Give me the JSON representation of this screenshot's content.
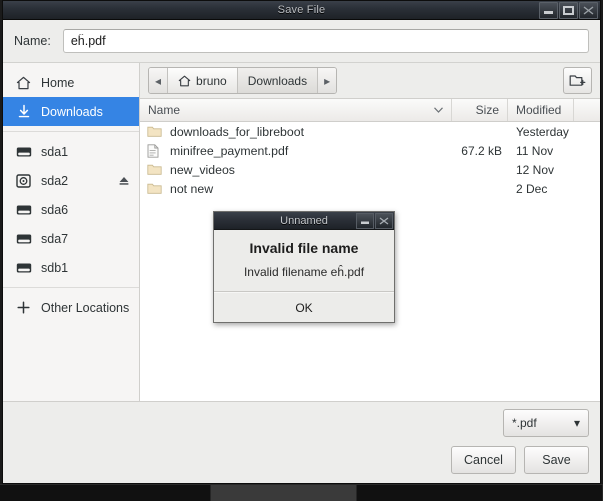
{
  "window": {
    "title": "Save File",
    "controls": [
      {
        "name": "minimize",
        "glyph": "minimize-icon"
      },
      {
        "name": "maximize",
        "glyph": "maximize-icon"
      },
      {
        "name": "close",
        "glyph": "close-icon"
      }
    ]
  },
  "name_row": {
    "label": "Name:",
    "value": "eĥ.pdf",
    "placeholder": ""
  },
  "sidebar": {
    "items": [
      {
        "label": "Home",
        "icon": "home-icon",
        "selected": false,
        "eject": false
      },
      {
        "label": "Downloads",
        "icon": "download-icon",
        "selected": true,
        "eject": false
      },
      {
        "label": "sda1",
        "icon": "drive-harddisk-icon",
        "selected": false,
        "eject": false
      },
      {
        "label": "sda2",
        "icon": "drive-optical-icon",
        "selected": false,
        "eject": true
      },
      {
        "label": "sda6",
        "icon": "drive-harddisk-icon",
        "selected": false,
        "eject": false
      },
      {
        "label": "sda7",
        "icon": "drive-harddisk-icon",
        "selected": false,
        "eject": false
      },
      {
        "label": "sdb1",
        "icon": "drive-harddisk-icon",
        "selected": false,
        "eject": false
      },
      {
        "label": "Other Locations",
        "icon": "plus-icon",
        "selected": false,
        "eject": false
      }
    ]
  },
  "pathbar": {
    "back_arrow": "◂",
    "forward_arrow": "▸",
    "crumbs": [
      {
        "label": "bruno",
        "icon": "home-icon",
        "current": false
      },
      {
        "label": "Downloads",
        "icon": "",
        "current": true
      }
    ],
    "new_folder_button": "create-folder-icon"
  },
  "file_list": {
    "columns": [
      {
        "key": "name",
        "label": "Name",
        "sort": "descending"
      },
      {
        "key": "size",
        "label": "Size"
      },
      {
        "key": "modified",
        "label": "Modified"
      }
    ],
    "rows": [
      {
        "icon": "folder-icon",
        "name": "downloads_for_libreboot",
        "size": "",
        "modified": "Yesterday"
      },
      {
        "icon": "document-icon",
        "name": "minifree_payment.pdf",
        "size": "67.2 kB",
        "modified": "11 Nov"
      },
      {
        "icon": "folder-icon",
        "name": "new_videos",
        "size": "",
        "modified": "12 Nov"
      },
      {
        "icon": "folder-icon",
        "name": "not new",
        "size": "",
        "modified": "2 Dec"
      }
    ]
  },
  "footer": {
    "filter": {
      "label": "*.pdf",
      "chevron": "▾"
    },
    "cancel_label": "Cancel",
    "save_label": "Save"
  },
  "modal": {
    "title": "Unnamed",
    "heading": "Invalid file name",
    "message": "Invalid filename eĥ.pdf",
    "ok_label": "OK",
    "controls": [
      {
        "name": "minimize",
        "glyph": "minimize-icon"
      },
      {
        "name": "close",
        "glyph": "close-icon"
      }
    ]
  },
  "colors": {
    "selection_blue": "#3584e4",
    "window_bg": "#ededeb",
    "sidebar_bg": "#f6f5f4",
    "titlebar_dark": "#2b3038",
    "folder_icon": "#f3e4c3",
    "text": "#2e3436"
  }
}
